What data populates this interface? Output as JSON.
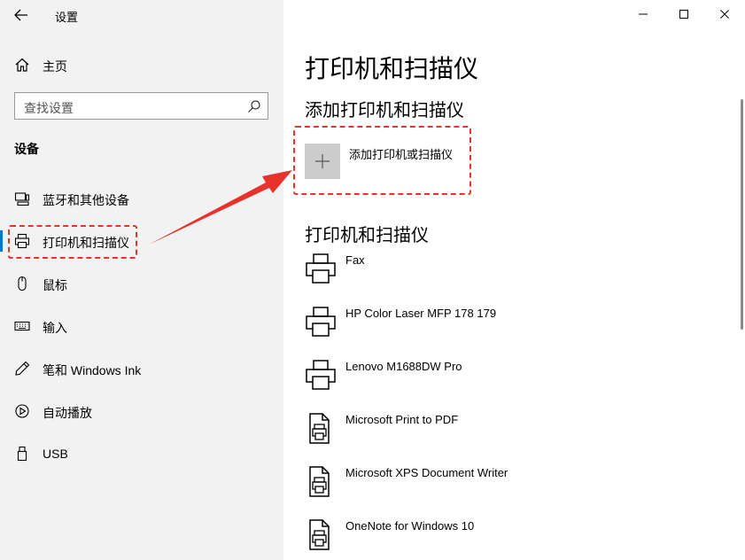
{
  "window": {
    "title": "设置",
    "accent": "#0078d7",
    "highlight_color": "#e8322c"
  },
  "sidebar": {
    "home_label": "主页",
    "search_placeholder": "查找设置",
    "section_title": "设备",
    "items": [
      {
        "label": "蓝牙和其他设备",
        "icon": "bluetooth-devices-icon"
      },
      {
        "label": "打印机和扫描仪",
        "icon": "printer-icon",
        "active": true
      },
      {
        "label": "鼠标",
        "icon": "mouse-icon"
      },
      {
        "label": "输入",
        "icon": "keyboard-icon"
      },
      {
        "label": "笔和 Windows Ink",
        "icon": "pen-icon"
      },
      {
        "label": "自动播放",
        "icon": "autoplay-icon"
      },
      {
        "label": "USB",
        "icon": "usb-icon"
      }
    ]
  },
  "main": {
    "title": "打印机和扫描仪",
    "add_section_title": "添加打印机和扫描仪",
    "add_button_label": "添加打印机或扫描仪",
    "list_section_title": "打印机和扫描仪",
    "printers": [
      {
        "name": "Fax",
        "icon": "printer-icon"
      },
      {
        "name": "HP Color Laser MFP 178 179",
        "icon": "printer-icon"
      },
      {
        "name": "Lenovo M1688DW Pro",
        "icon": "printer-icon"
      },
      {
        "name": "Microsoft Print to PDF",
        "icon": "document-printer-icon"
      },
      {
        "name": "Microsoft XPS Document Writer",
        "icon": "document-printer-icon"
      },
      {
        "name": "OneNote for Windows 10",
        "icon": "document-printer-icon"
      }
    ]
  }
}
